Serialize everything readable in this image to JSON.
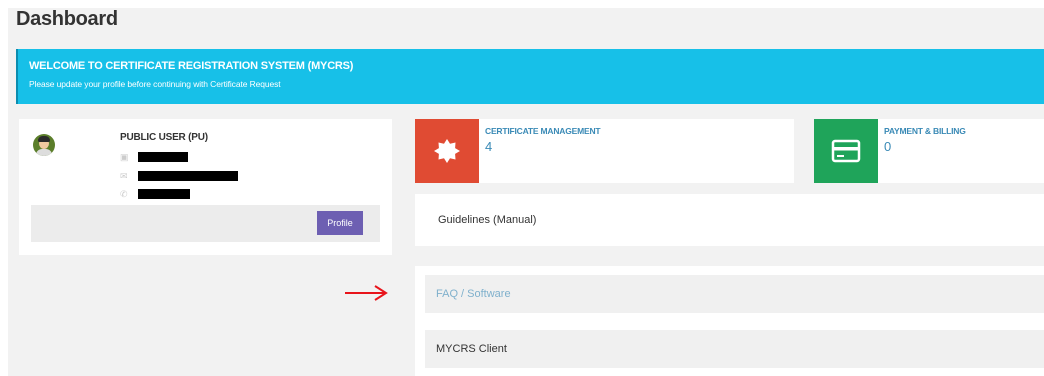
{
  "page": {
    "title": "Dashboard"
  },
  "banner": {
    "title": "WELCOME TO CERTIFICATE REGISTRATION SYSTEM (MYCRS)",
    "subtitle": "Please update your profile before continuing with Certificate Request",
    "color": "#17c0e8"
  },
  "user": {
    "name": "PUBLIC USER (PU)",
    "avatar_icon": "user-avatar-icon",
    "info_icons": [
      "id-card-icon",
      "envelope-icon",
      "phone-icon"
    ],
    "profile_button": "Profile",
    "profile_button_color": "#6d5fb2"
  },
  "tiles": [
    {
      "label": "CERTIFICATE MANAGEMENT",
      "count": "4",
      "icon": "certificate-seal-icon",
      "color": "#e04b33"
    },
    {
      "label": "PAYMENT & BILLING",
      "count": "0",
      "icon": "credit-card-icon",
      "color": "#1fa45a"
    }
  ],
  "guidelines": {
    "label": "Guidelines (Manual)"
  },
  "faq": {
    "label": "FAQ / Software"
  },
  "client": {
    "label": "MYCRS Client"
  },
  "annotation": {
    "icon": "red-arrow-icon",
    "color": "#e8141b"
  }
}
